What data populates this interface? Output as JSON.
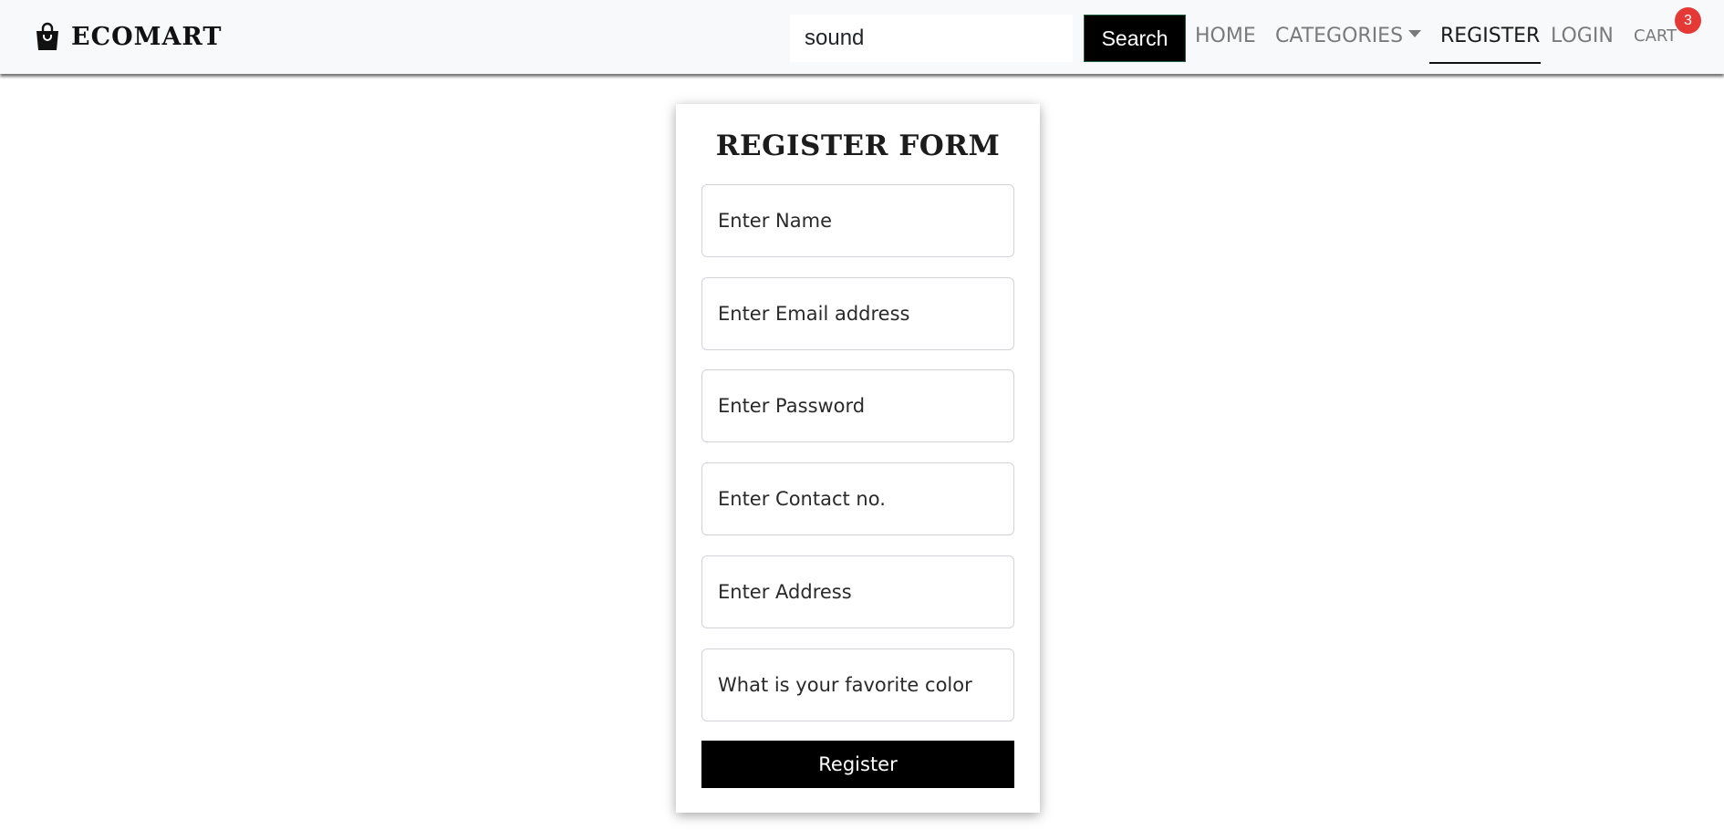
{
  "brand": {
    "name": "ECOMART",
    "icon": "shopping-bag-icon"
  },
  "search": {
    "value": "sound",
    "button_label": "Search"
  },
  "nav": {
    "home": "HOME",
    "categories": "CATEGORIES",
    "register": "REGISTER",
    "login": "LOGIN",
    "cart": "CART",
    "cart_count": "3",
    "active": "register"
  },
  "form": {
    "title": "REGISTER FORM",
    "fields": [
      {
        "placeholder": "Enter Name"
      },
      {
        "placeholder": "Enter Email address"
      },
      {
        "placeholder": "Enter Password"
      },
      {
        "placeholder": "Enter Contact no."
      },
      {
        "placeholder": "Enter Address"
      },
      {
        "placeholder": "What is your favorite color"
      }
    ],
    "submit_label": "Register"
  },
  "colors": {
    "navbar_bg": "#f8f9fa",
    "primary_button": "#000000",
    "badge": "#e53935",
    "nav_link": "#7a7a7a"
  }
}
